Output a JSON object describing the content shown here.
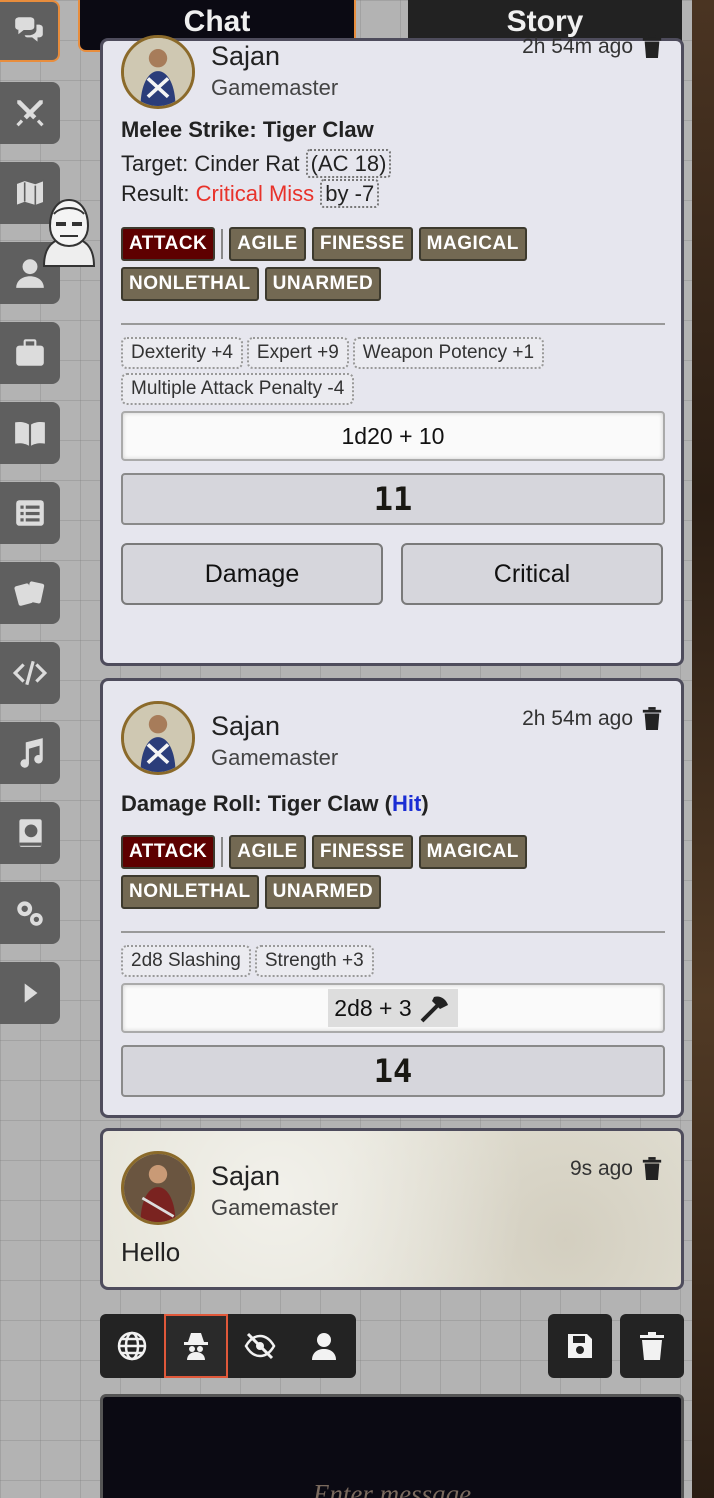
{
  "tabs": {
    "chat": "Chat",
    "story": "Story"
  },
  "dock": {
    "items": [
      {
        "icon": "chat-bubbles-icon"
      },
      {
        "icon": "crossed-swords-icon"
      },
      {
        "icon": "map-icon"
      },
      {
        "icon": "user-icon"
      },
      {
        "icon": "briefcase-icon"
      },
      {
        "icon": "open-book-icon"
      },
      {
        "icon": "list-icon"
      },
      {
        "icon": "cards-icon"
      },
      {
        "icon": "code-icon"
      },
      {
        "icon": "music-note-icon"
      },
      {
        "icon": "journal-globe-icon"
      },
      {
        "icon": "gears-icon"
      },
      {
        "icon": "caret-right-icon"
      }
    ]
  },
  "messages": [
    {
      "speaker": "Sajan",
      "subtitle": "Gamemaster",
      "timestamp": "2h 54m ago",
      "title": "Melee Strike: Tiger Claw",
      "target_label": "Target: Cinder Rat",
      "target_ac": "(AC 18)",
      "result_label": "Result:",
      "result_value": "Critical Miss",
      "result_by": "by -7",
      "tags": [
        "ATTACK",
        "AGILE",
        "FINESSE",
        "MAGICAL",
        "NONLETHAL",
        "UNARMED"
      ],
      "modifiers": [
        "Dexterity +4",
        "Expert +9",
        "Weapon Potency +1",
        "Multiple Attack Penalty -4"
      ],
      "formula": "1d20 + 10",
      "total": "11",
      "buttons": {
        "damage": "Damage",
        "critical": "Critical"
      }
    },
    {
      "speaker": "Sajan",
      "subtitle": "Gamemaster",
      "timestamp": "2h 54m ago",
      "title": "Damage Roll: Tiger Claw (",
      "title_hit": "Hit",
      "title_end": ")",
      "tags": [
        "ATTACK",
        "AGILE",
        "FINESSE",
        "MAGICAL",
        "NONLETHAL",
        "UNARMED"
      ],
      "modifiers": [
        "2d8 Slashing",
        "Strength +3"
      ],
      "formula": "2d8 + 3",
      "total": "14"
    },
    {
      "speaker": "Sajan",
      "subtitle": "Gamemaster",
      "timestamp": "9s ago",
      "text": "Hello"
    }
  ],
  "controls": {
    "roll_modes": [
      {
        "icon": "globe-icon"
      },
      {
        "icon": "incognito-icon"
      },
      {
        "icon": "eye-slash-icon"
      },
      {
        "icon": "person-icon"
      }
    ],
    "export_icon": "floppy-disk-icon",
    "clear_icon": "trash-icon"
  },
  "input": {
    "placeholder": "Enter message"
  }
}
